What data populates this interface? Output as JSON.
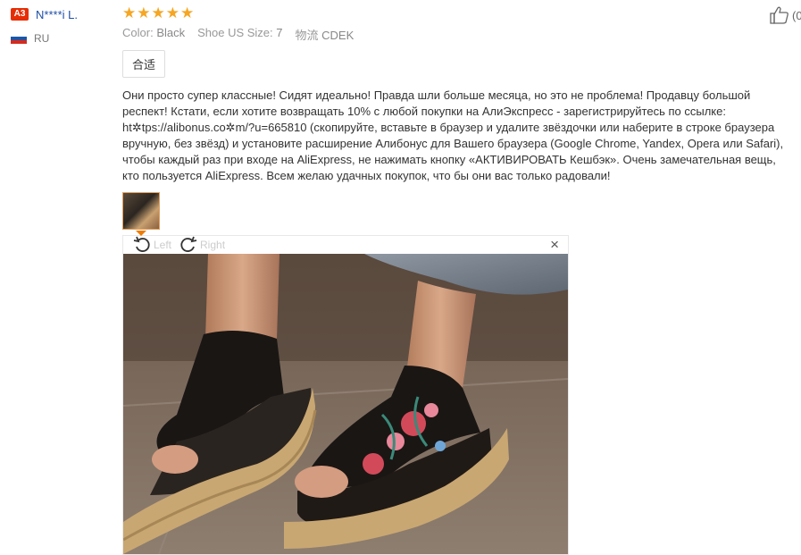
{
  "reviewer": {
    "level_badge": "A3",
    "name": "N****i L.",
    "country": "RU",
    "flag_colors": [
      "#ffffff",
      "#1c57a7",
      "#d52b1e"
    ]
  },
  "review": {
    "rating": 5,
    "stars": [
      "★",
      "★",
      "★",
      "★",
      "★"
    ],
    "star_color": "#f5a623",
    "attributes": [
      {
        "key": "Color:",
        "value": "Black"
      },
      {
        "key": "Shoe US Size:",
        "value": "7"
      },
      {
        "key": "物流",
        "value": "CDEK"
      }
    ],
    "fit_tag": "合适",
    "text": "Они просто супер классные! Сидят идеально! Правда шли больше месяца, но это не проблема! Продавцу большой респект! Кстати, если хотите возвращать 10% с любой покупки на АлиЭкспресс - зарегистрируйтесь по ссылке: ht✲tps://alibonus.co✲m/?u=665810 (скопируйте, вставьте в браузер и удалите звёздочки или наберите в строке браузера вручную, без звёзд) и установите расширение Алибонус для Вашего браузера (Google Chrome, Yandex, Opera или Safari), чтобы каждый раз при входе на AliExpress, не нажимать кнопку «АКТИВИРОВАТЬ Кешбэк». Очень замечательная вещь, кто пользуется AliExpress. Всем желаю удачных покупок, что бы они вас только радовали!"
  },
  "helpful": {
    "count_text": "(0"
  },
  "viewer": {
    "rotate_left_label": "Left",
    "rotate_right_label": "Right",
    "close_glyph": "×"
  },
  "colors": {
    "badge": "#e62e04",
    "link": "#1f4fa6",
    "thumb_border": "#e0a060",
    "thumb_arrow": "#f07c00"
  }
}
